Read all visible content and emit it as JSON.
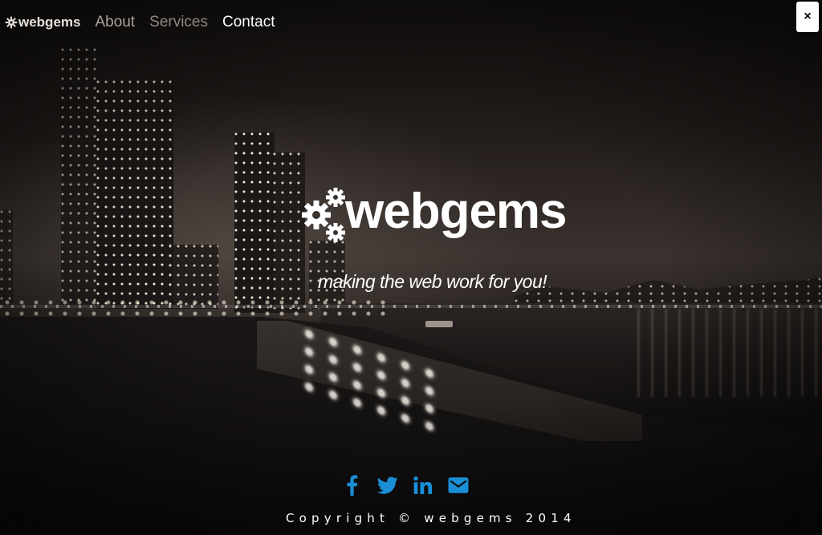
{
  "nav": {
    "brand": "webgems",
    "items": [
      {
        "label": "About"
      },
      {
        "label": "Services"
      },
      {
        "label": "Contact"
      }
    ],
    "close_label": "×"
  },
  "hero": {
    "title": "webgems",
    "tagline": "making the web work for you!"
  },
  "footer": {
    "social": [
      {
        "name": "facebook-icon"
      },
      {
        "name": "twitter-icon"
      },
      {
        "name": "linkedin-icon"
      },
      {
        "name": "email-icon"
      }
    ],
    "copyright": "Copyright © webgems 2014"
  },
  "colors": {
    "accent": "#1a8fd6",
    "text": "#ffffff",
    "nav_muted": "#a9a39d"
  }
}
